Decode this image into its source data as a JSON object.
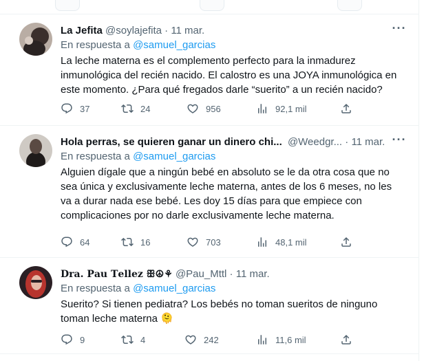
{
  "tweets": [
    {
      "name": "La Jefita",
      "handle": "@soylajefita",
      "dot": "·",
      "date": "11 mar.",
      "reply_prefix": "En respuesta a",
      "reply_handle": "@samuel_garcias",
      "text": "La leche materna es el complemento perfecto para la inmadurez inmunológica del recién nacido. El calostro es una JOYA inmunológica en este momento. ¿Para qué fregados darle “suerito” a un recién nacido?",
      "stats": {
        "replies": "37",
        "reposts": "24",
        "likes": "956",
        "views": "92,1 mil"
      }
    },
    {
      "name": "Hola perras, se quieren ganar un dinero chi...",
      "handle": "@Weedgr...",
      "dot": "·",
      "date": "11 mar.",
      "reply_prefix": "En respuesta a",
      "reply_handle": "@samuel_garcias",
      "text": "Alguien dígale que a ningún bebé en absoluto se le da otra cosa que no sea única y exclusivamente leche materna, antes de los 6 meses, no les va a durar nada ese bebé.  Les doy 15 días para que empiece con complicaciones por no darle exclusivamente leche materna.",
      "stats": {
        "replies": "64",
        "reposts": "16",
        "likes": "703",
        "views": "48,1 mil"
      }
    },
    {
      "name": "𝐃𝐫𝐚. 𝐏𝐚𝐮 𝐓𝐞𝐥𝐥𝐞𝐳 ꕥ☮︎⚘",
      "handle": "@Pau_Mttl",
      "dot": "·",
      "date": "11 mar.",
      "reply_prefix": "En respuesta a",
      "reply_handle": "@samuel_garcias",
      "text": "Suerito? Si tienen pediatra? Los bebés no toman sueritos de ninguno toman leche materna 🫠",
      "stats": {
        "replies": "9",
        "reposts": "4",
        "likes": "242",
        "views": "11,6 mil"
      }
    }
  ],
  "more_label": "···",
  "icons": [
    "reply-icon",
    "repost-icon",
    "like-icon",
    "views-icon",
    "share-icon",
    "more-icon"
  ],
  "colors": {
    "link": "#1d9bf0",
    "muted": "#536471",
    "text": "#0f1419",
    "border": "#eff3f4"
  }
}
